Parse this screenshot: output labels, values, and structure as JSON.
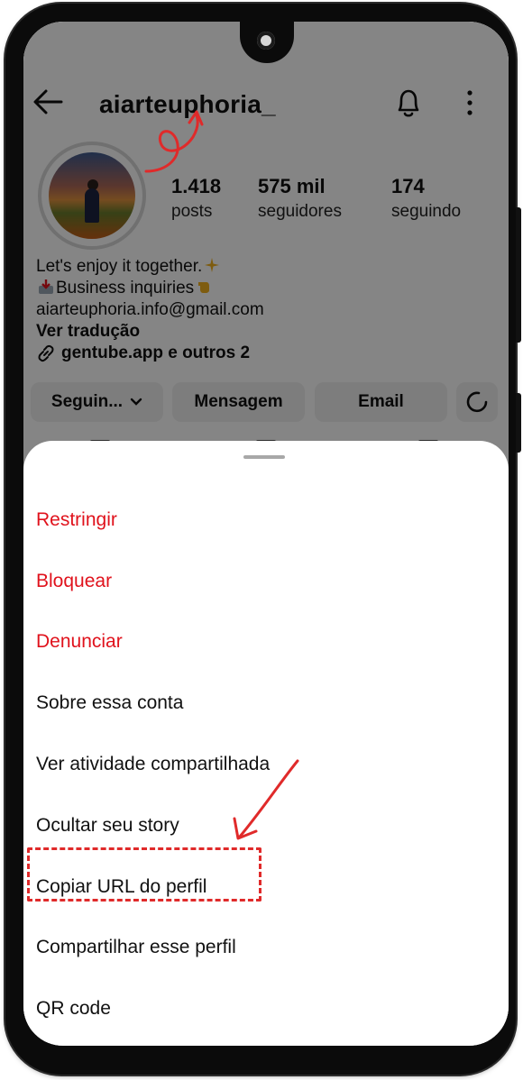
{
  "profile": {
    "username": "aiarteuphoria_",
    "stats": [
      {
        "value": "1.418",
        "label": "posts"
      },
      {
        "value": "575 mil",
        "label": "seguidores"
      },
      {
        "value": "174",
        "label": "seguindo"
      }
    ],
    "bio": {
      "line1": "Let's enjoy it together.",
      "line2": "Business inquiries",
      "email": "aiarteuphoria.info@gmail.com",
      "translate": "Ver tradução",
      "link": "gentube.app e outros 2"
    },
    "buttons": {
      "following": "Seguin...",
      "message": "Mensagem",
      "email": "Email"
    }
  },
  "sheet": {
    "items": [
      {
        "label": "Restringir",
        "danger": true
      },
      {
        "label": "Bloquear",
        "danger": true
      },
      {
        "label": "Denunciar",
        "danger": true
      },
      {
        "label": "Sobre essa conta"
      },
      {
        "label": "Ver atividade compartilhada"
      },
      {
        "label": "Ocultar seu story"
      },
      {
        "label": "Copiar URL do perfil"
      },
      {
        "label": "Compartilhar esse perfil"
      },
      {
        "label": "QR code"
      }
    ]
  },
  "colors": {
    "danger": "#e0121c",
    "annotation": "#e02a2a",
    "overlay": "rgba(0,0,0,0.48)"
  },
  "icons": [
    "back-arrow-icon",
    "bell-icon",
    "more-vertical-icon",
    "sparkles-icon",
    "inbox-tray-icon",
    "pointing-hand-icon",
    "link-icon",
    "chevron-down-icon",
    "add-user-icon"
  ]
}
